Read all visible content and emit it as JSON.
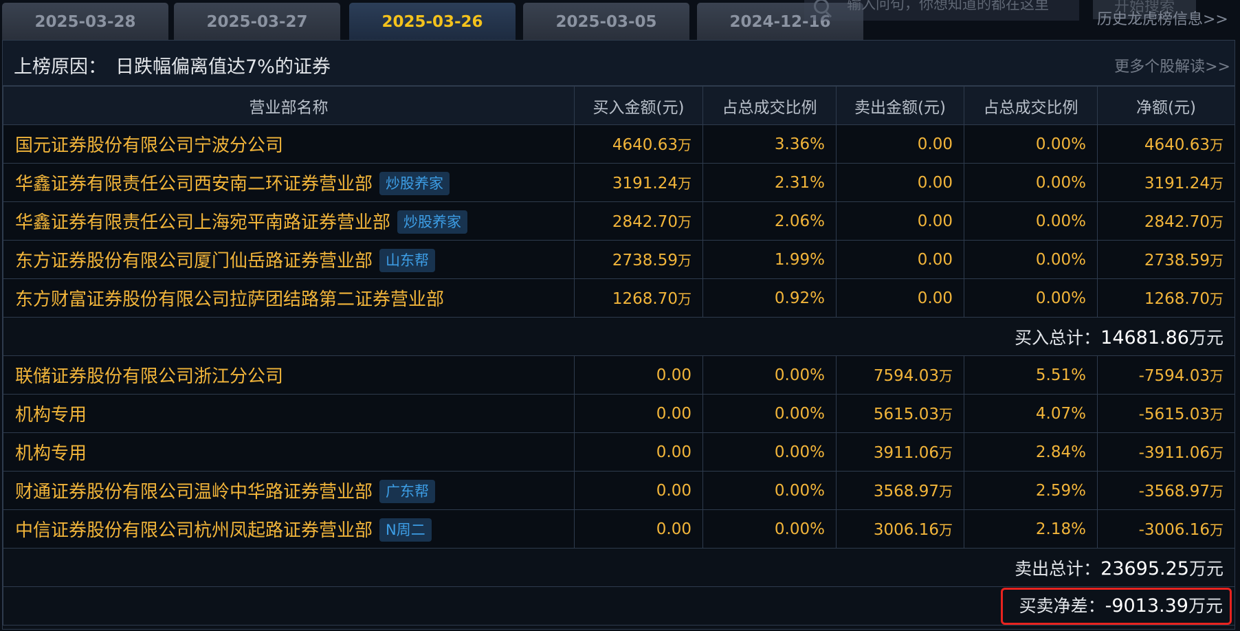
{
  "tabs": [
    {
      "label": "2025-03-28",
      "active": false
    },
    {
      "label": "2025-03-27",
      "active": false
    },
    {
      "label": "2025-03-26",
      "active": true
    },
    {
      "label": "2025-03-05",
      "active": false
    },
    {
      "label": "2024-12-16",
      "active": false
    }
  ],
  "search": {
    "placeholder": "输入问句，你想知道的都在这里",
    "button_label": "开始搜索",
    "history_link": "历史龙虎榜信息>>"
  },
  "reason": {
    "label": "上榜原因：",
    "text": "日跌幅偏离值达7%的证券",
    "more_link": "更多个股解读>>"
  },
  "table": {
    "headers": [
      "营业部名称",
      "买入金额(元)",
      "占总成交比例",
      "卖出金额(元)",
      "占总成交比例",
      "净额(元)"
    ],
    "unit_wan": "万",
    "buy_rows": [
      {
        "name": "国元证券股份有限公司宁波分公司",
        "tag": "",
        "buy": "4640.63",
        "buy_pct": "3.36%",
        "sell": "0.00",
        "sell_pct": "0.00%",
        "net": "4640.63"
      },
      {
        "name": "华鑫证券有限责任公司西安南二环证券营业部",
        "tag": "炒股养家",
        "buy": "3191.24",
        "buy_pct": "2.31%",
        "sell": "0.00",
        "sell_pct": "0.00%",
        "net": "3191.24"
      },
      {
        "name": "华鑫证券有限责任公司上海宛平南路证券营业部",
        "tag": "炒股养家",
        "buy": "2842.70",
        "buy_pct": "2.06%",
        "sell": "0.00",
        "sell_pct": "0.00%",
        "net": "2842.70"
      },
      {
        "name": "东方证券股份有限公司厦门仙岳路证券营业部",
        "tag": "山东帮",
        "buy": "2738.59",
        "buy_pct": "1.99%",
        "sell": "0.00",
        "sell_pct": "0.00%",
        "net": "2738.59"
      },
      {
        "name": "东方财富证券股份有限公司拉萨团结路第二证券营业部",
        "tag": "",
        "buy": "1268.70",
        "buy_pct": "0.92%",
        "sell": "0.00",
        "sell_pct": "0.00%",
        "net": "1268.70"
      }
    ],
    "buy_total": {
      "label": "买入总计：",
      "value": "14681.86",
      "unit": "万元"
    },
    "sell_rows": [
      {
        "name": "联储证券股份有限公司浙江分公司",
        "tag": "",
        "buy": "0.00",
        "buy_pct": "0.00%",
        "sell": "7594.03",
        "sell_pct": "5.51%",
        "net": "-7594.03"
      },
      {
        "name": "机构专用",
        "tag": "",
        "buy": "0.00",
        "buy_pct": "0.00%",
        "sell": "5615.03",
        "sell_pct": "4.07%",
        "net": "-5615.03"
      },
      {
        "name": "机构专用",
        "tag": "",
        "buy": "0.00",
        "buy_pct": "0.00%",
        "sell": "3911.06",
        "sell_pct": "2.84%",
        "net": "-3911.06"
      },
      {
        "name": "财通证券股份有限公司温岭中华路证券营业部",
        "tag": "广东帮",
        "buy": "0.00",
        "buy_pct": "0.00%",
        "sell": "3568.97",
        "sell_pct": "2.59%",
        "net": "-3568.97"
      },
      {
        "name": "中信证券股份有限公司杭州凤起路证券营业部",
        "tag": "N周二",
        "buy": "0.00",
        "buy_pct": "0.00%",
        "sell": "3006.16",
        "sell_pct": "2.18%",
        "net": "-3006.16"
      }
    ],
    "sell_total": {
      "label": "卖出总计：",
      "value": "23695.25",
      "unit": "万元"
    },
    "net_diff": {
      "label": "买卖净差：",
      "value": "-9013.39",
      "unit": "万元"
    }
  },
  "colors": {
    "accent": "#f4c21c",
    "value": "#f2b53a",
    "tag_text": "#3d9ee6",
    "highlight_border": "#e8231f"
  }
}
